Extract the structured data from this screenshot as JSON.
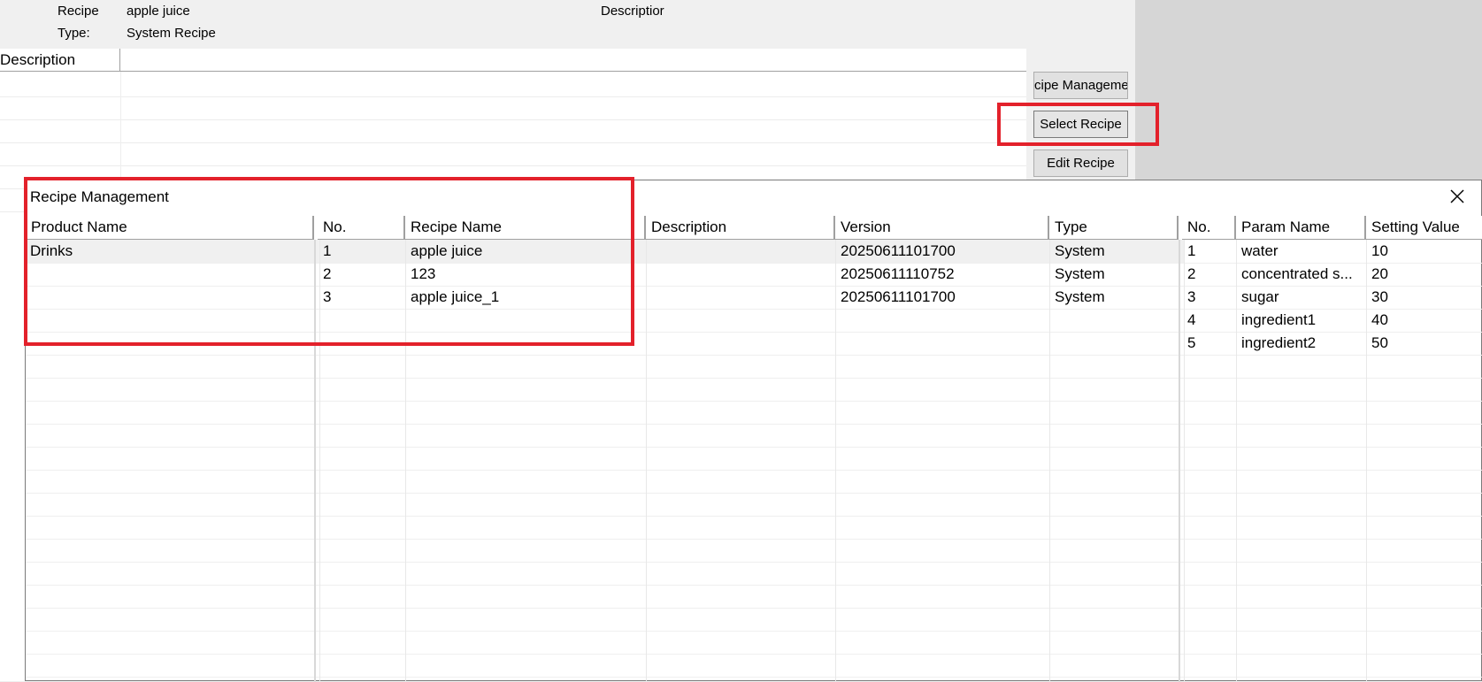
{
  "background_window": {
    "recipe_label": "Recipe",
    "recipe_value": "apple juice",
    "type_label": "Type:",
    "type_value": "System Recipe",
    "description_label": "Descriptior",
    "list_header_description": "Description",
    "buttons": {
      "recipe_management": "cipe Manageme",
      "select_recipe": "Select Recipe",
      "edit_recipe": "Edit Recipe"
    }
  },
  "dialog": {
    "title": "Recipe Management",
    "close_icon": "close-icon",
    "products": {
      "header": "Product Name",
      "rows": [
        "Drinks"
      ]
    },
    "recipes": {
      "headers": {
        "no": "No.",
        "name": "Recipe Name",
        "description": "Description",
        "version": "Version",
        "type": "Type"
      },
      "rows": [
        {
          "no": "1",
          "name": "apple juice",
          "description": "",
          "version": "20250611101700",
          "type": "System"
        },
        {
          "no": "2",
          "name": "123",
          "description": "",
          "version": "20250611110752",
          "type": "System"
        },
        {
          "no": "3",
          "name": "apple juice_1",
          "description": "",
          "version": "20250611101700",
          "type": "System"
        }
      ]
    },
    "params": {
      "headers": {
        "no": "No.",
        "name": "Param Name",
        "value": "Setting Value"
      },
      "rows": [
        {
          "no": "1",
          "name": "water",
          "value": "10"
        },
        {
          "no": "2",
          "name": "concentrated s...",
          "value": "20"
        },
        {
          "no": "3",
          "name": "sugar",
          "value": "30"
        },
        {
          "no": "4",
          "name": "ingredient1",
          "value": "40"
        },
        {
          "no": "5",
          "name": "ingredient2",
          "value": "50"
        }
      ]
    }
  },
  "colors": {
    "highlight": "#e3212b",
    "selected_row": "#f0f0f0"
  }
}
